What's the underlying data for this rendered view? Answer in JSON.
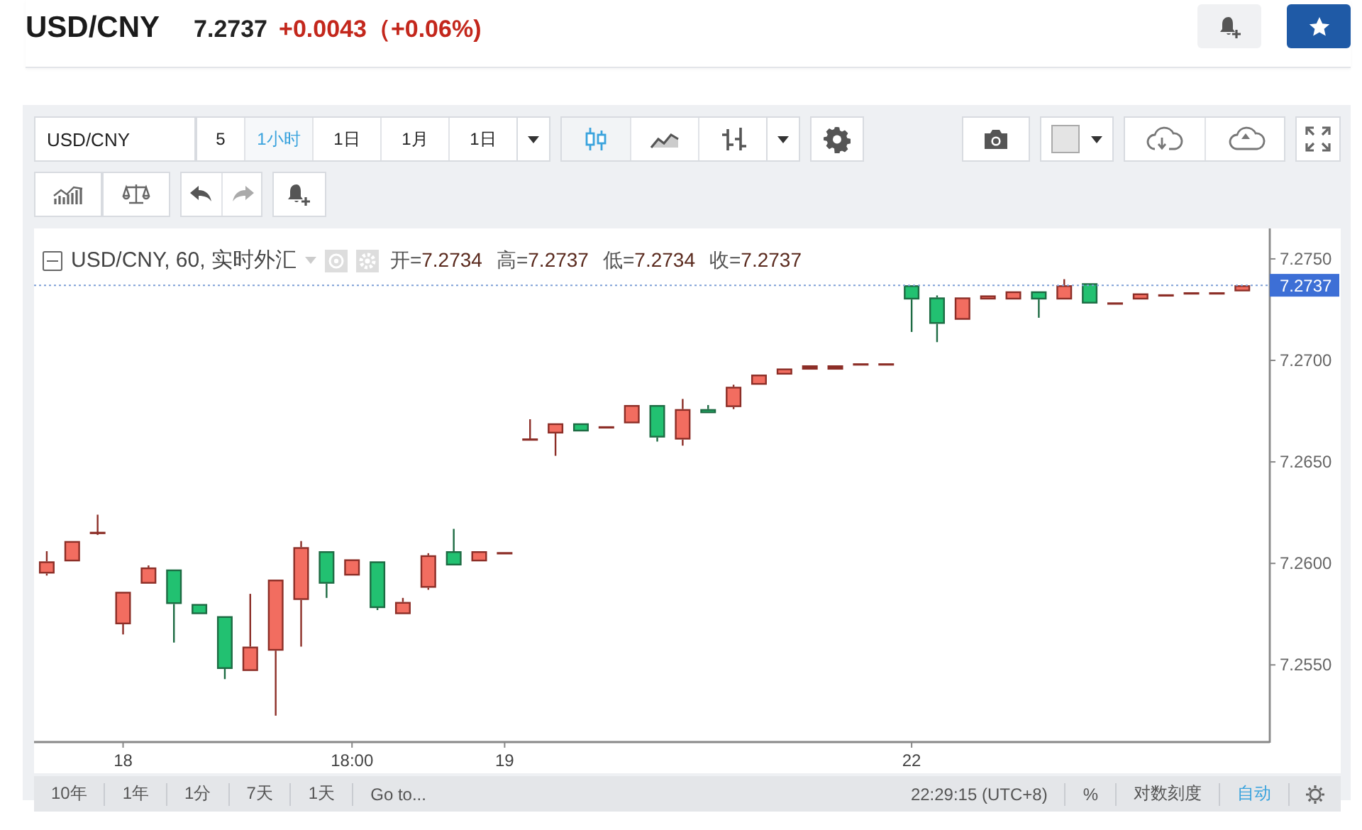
{
  "header": {
    "symbol": "USD/CNY",
    "price": "7.2737",
    "change": "+0.0043（+0.06%)"
  },
  "toolbar": {
    "symbol": "USD/CNY",
    "intervals": [
      {
        "label": "5",
        "selected": false
      },
      {
        "label": "1小时",
        "selected": true
      },
      {
        "label": "1日",
        "selected": false
      },
      {
        "label": "1月",
        "selected": false
      },
      {
        "label": "1日",
        "selected": false
      }
    ],
    "chart_styles": [
      {
        "kind": "candles",
        "selected": true
      },
      {
        "kind": "area",
        "selected": false
      },
      {
        "kind": "bars",
        "selected": false
      }
    ]
  },
  "legend": {
    "title": "USD/CNY, 60, 实时外汇",
    "values": [
      {
        "label": "开=",
        "value": "7.2734"
      },
      {
        "label": "高=",
        "value": "7.2737"
      },
      {
        "label": "低=",
        "value": "7.2734"
      },
      {
        "label": "收=",
        "value": "7.2737"
      }
    ]
  },
  "chart_data": {
    "type": "candlestick",
    "ylim": [
      7.2512,
      7.2765
    ],
    "yticks": [
      {
        "value": 7.255,
        "label": "7.2550"
      },
      {
        "value": 7.26,
        "label": "7.2600"
      },
      {
        "value": 7.265,
        "label": "7.2650"
      },
      {
        "value": 7.27,
        "label": "7.2700"
      },
      {
        "value": 7.275,
        "label": "7.2750"
      }
    ],
    "ref_lines": [
      {
        "axis": "y",
        "value": 7.2737,
        "label": "7.2737"
      }
    ],
    "categories": [
      null,
      null,
      null,
      "18",
      null,
      null,
      null,
      null,
      null,
      null,
      null,
      null,
      "18:00",
      null,
      null,
      null,
      null,
      null,
      "19",
      null,
      null,
      null,
      null,
      null,
      null,
      null,
      null,
      null,
      null,
      null,
      null,
      null,
      null,
      null,
      "22",
      null,
      null,
      null,
      null,
      null,
      null,
      null,
      null,
      null,
      null,
      null,
      null,
      null
    ],
    "ohlc": [
      [
        7.2595,
        7.2606,
        7.2594,
        7.2601
      ],
      [
        7.2601,
        7.2611,
        7.2601,
        7.2611
      ],
      [
        7.2615,
        7.2624,
        7.2614,
        7.2615
      ],
      [
        7.257,
        7.2586,
        7.2565,
        7.2586
      ],
      [
        7.259,
        7.2599,
        7.259,
        7.2598
      ],
      [
        7.2597,
        7.2597,
        7.2561,
        7.258
      ],
      [
        7.258,
        7.258,
        7.2575,
        7.2575
      ],
      [
        7.2574,
        7.2574,
        7.2543,
        7.2548
      ],
      [
        7.2547,
        7.2585,
        7.2547,
        7.2559
      ],
      [
        7.2557,
        7.2592,
        7.2525,
        7.2592
      ],
      [
        7.2582,
        7.2611,
        7.2559,
        7.2608
      ],
      [
        7.2606,
        7.2606,
        7.2583,
        7.259
      ],
      [
        7.2594,
        7.2602,
        7.2594,
        7.2602
      ],
      [
        7.2601,
        7.2601,
        7.2577,
        7.2578
      ],
      [
        7.2575,
        7.2583,
        7.2575,
        7.2581
      ],
      [
        7.2588,
        7.2605,
        7.2587,
        7.2604
      ],
      [
        7.2606,
        7.2617,
        7.2599,
        7.2599
      ],
      [
        7.2601,
        7.2606,
        7.2601,
        7.2606
      ],
      [
        7.2605,
        7.2605,
        7.2605,
        7.2605
      ],
      [
        7.2661,
        7.2671,
        7.2661,
        7.2661
      ],
      [
        7.2664,
        7.2669,
        7.2653,
        7.2669
      ],
      [
        7.2669,
        7.2669,
        7.2665,
        7.2665
      ],
      [
        7.2667,
        7.2667,
        7.2667,
        7.2667
      ],
      [
        7.2669,
        7.2678,
        7.2669,
        7.2678
      ],
      [
        7.2678,
        7.2678,
        7.266,
        7.2662
      ],
      [
        7.2661,
        7.2681,
        7.2658,
        7.2676
      ],
      [
        7.2676,
        7.2678,
        7.2674,
        7.2674
      ],
      [
        7.2677,
        7.2688,
        7.2676,
        7.2687
      ],
      [
        7.2688,
        7.2693,
        7.2688,
        7.2693
      ],
      [
        7.2693,
        7.2696,
        7.2693,
        7.2696
      ],
      [
        7.2696,
        7.2697,
        7.2696,
        7.2697
      ],
      [
        7.2696,
        7.2697,
        7.2696,
        7.2697
      ],
      [
        7.2698,
        7.2698,
        7.2698,
        7.2698
      ],
      [
        7.2698,
        7.2698,
        7.2698,
        7.2698
      ],
      [
        7.2737,
        7.2737,
        7.2714,
        7.273
      ],
      [
        7.2731,
        7.2732,
        7.2709,
        7.2718
      ],
      [
        7.272,
        7.2731,
        7.272,
        7.2731
      ],
      [
        7.273,
        7.2732,
        7.273,
        7.2732
      ],
      [
        7.273,
        7.2734,
        7.273,
        7.2734
      ],
      [
        7.2734,
        7.2734,
        7.2721,
        7.273
      ],
      [
        7.273,
        7.274,
        7.273,
        7.2737
      ],
      [
        7.2738,
        7.2738,
        7.2728,
        7.2728
      ],
      [
        7.2728,
        7.2728,
        7.2728,
        7.2728
      ],
      [
        7.273,
        7.2733,
        7.273,
        7.2733
      ],
      [
        7.2732,
        7.2732,
        7.2732,
        7.2732
      ],
      [
        7.2733,
        7.2733,
        7.2733,
        7.2733
      ],
      [
        7.2733,
        7.2733,
        7.2733,
        7.2733
      ],
      [
        7.2734,
        7.2737,
        7.2734,
        7.2737
      ]
    ]
  },
  "bottom_bar": {
    "ranges": [
      "10年",
      "1年",
      "1分",
      "7天",
      "1天",
      "Go to..."
    ],
    "clock": "22:29:15 (UTC+8)",
    "scale_options": [
      {
        "label": "%",
        "selected": false
      },
      {
        "label": "对数刻度",
        "selected": false
      },
      {
        "label": "自动",
        "selected": true
      }
    ]
  }
}
